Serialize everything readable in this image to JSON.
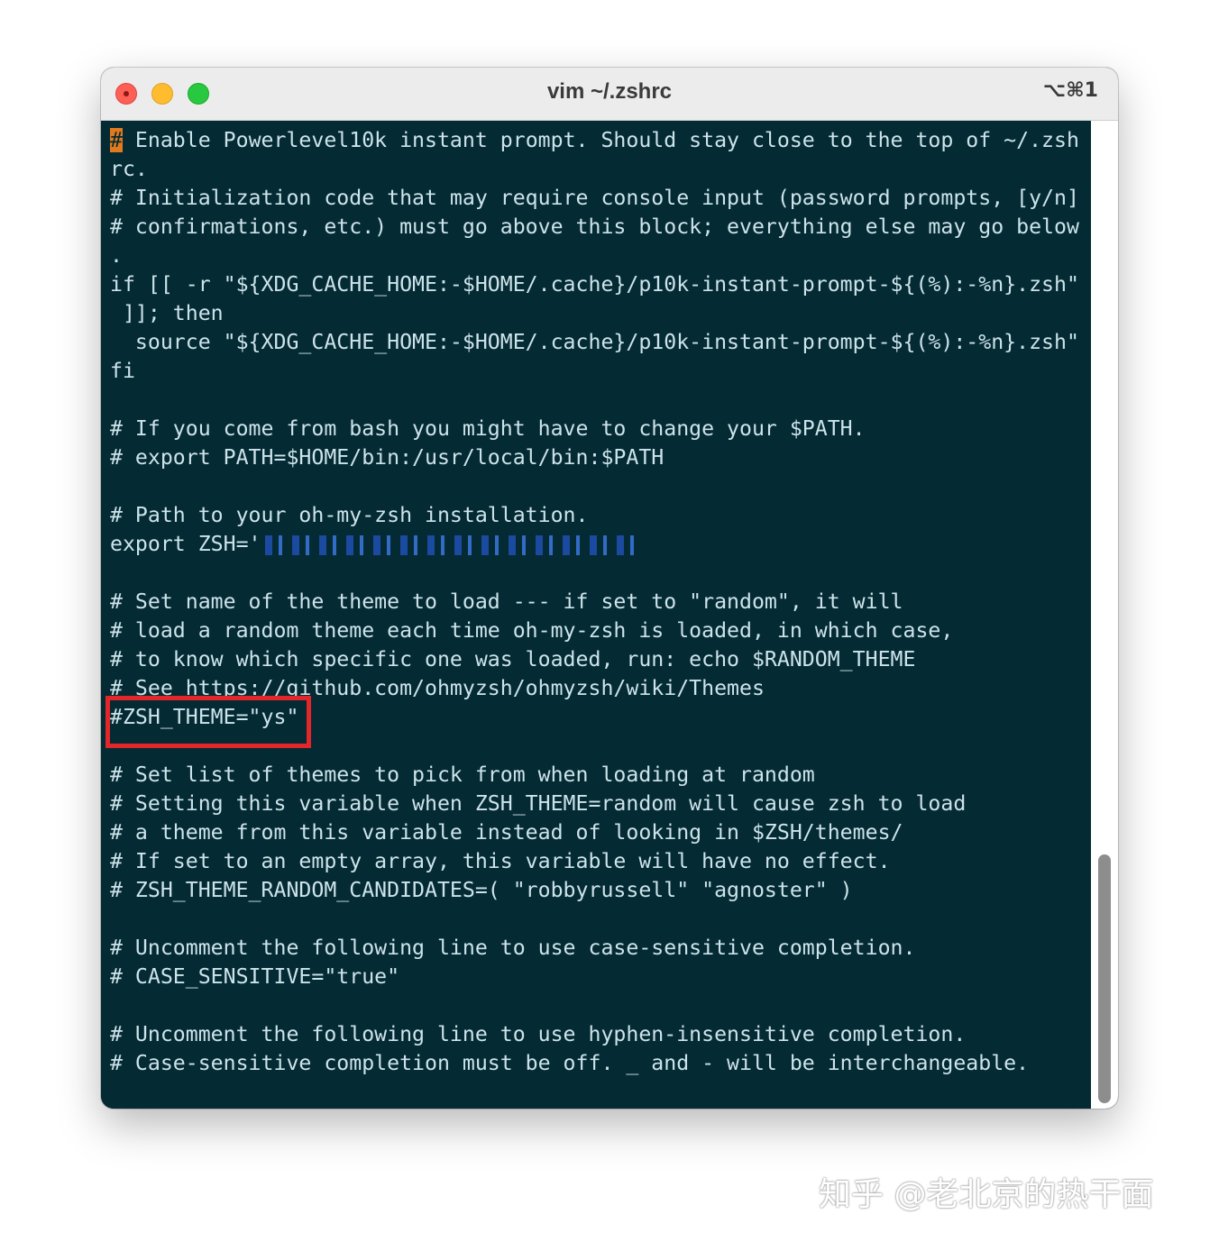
{
  "window": {
    "title": "vim ~/.zshrc",
    "shortcut": "⌥⌘1"
  },
  "editor": {
    "cursor_char": "#",
    "lines": [
      " Enable Powerlevel10k instant prompt. Should stay close to the top of ~/.zsh",
      "rc.",
      "# Initialization code that may require console input (password prompts, [y/n]",
      "# confirmations, etc.) must go above this block; everything else may go below",
      ".",
      "if [[ -r \"${XDG_CACHE_HOME:-$HOME/.cache}/p10k-instant-prompt-${(%):-%n}.zsh\"",
      " ]]; then",
      "  source \"${XDG_CACHE_HOME:-$HOME/.cache}/p10k-instant-prompt-${(%):-%n}.zsh\"",
      "fi",
      "",
      "# If you come from bash you might have to change your $PATH.",
      "# export PATH=$HOME/bin:/usr/local/bin:$PATH",
      "",
      "# Path to your oh-my-zsh installation.",
      "export ZSH='",
      "",
      "# Set name of the theme to load --- if set to \"random\", it will",
      "# load a random theme each time oh-my-zsh is loaded, in which case,",
      "# to know which specific one was loaded, run: echo $RANDOM_THEME",
      "# See https://github.com/ohmyzsh/ohmyzsh/wiki/Themes",
      "#ZSH_THEME=\"ys\"",
      "",
      "# Set list of themes to pick from when loading at random",
      "# Setting this variable when ZSH_THEME=random will cause zsh to load",
      "# a theme from this variable instead of looking in $ZSH/themes/",
      "# If set to an empty array, this variable will have no effect.",
      "# ZSH_THEME_RANDOM_CANDIDATES=( \"robbyrussell\" \"agnoster\" )",
      "",
      "# Uncomment the following line to use case-sensitive completion.",
      "# CASE_SENSITIVE=\"true\"",
      "",
      "# Uncomment the following line to use hyphen-insensitive completion.",
      "# Case-sensitive completion must be off. _ and - will be interchangeable."
    ]
  },
  "watermark": "知乎 @老北京的热干面",
  "colors": {
    "terminal_bg": "#042a33",
    "text": "#cde3ea",
    "cursor": "#e07a1e",
    "highlight_box": "#e3262a"
  }
}
